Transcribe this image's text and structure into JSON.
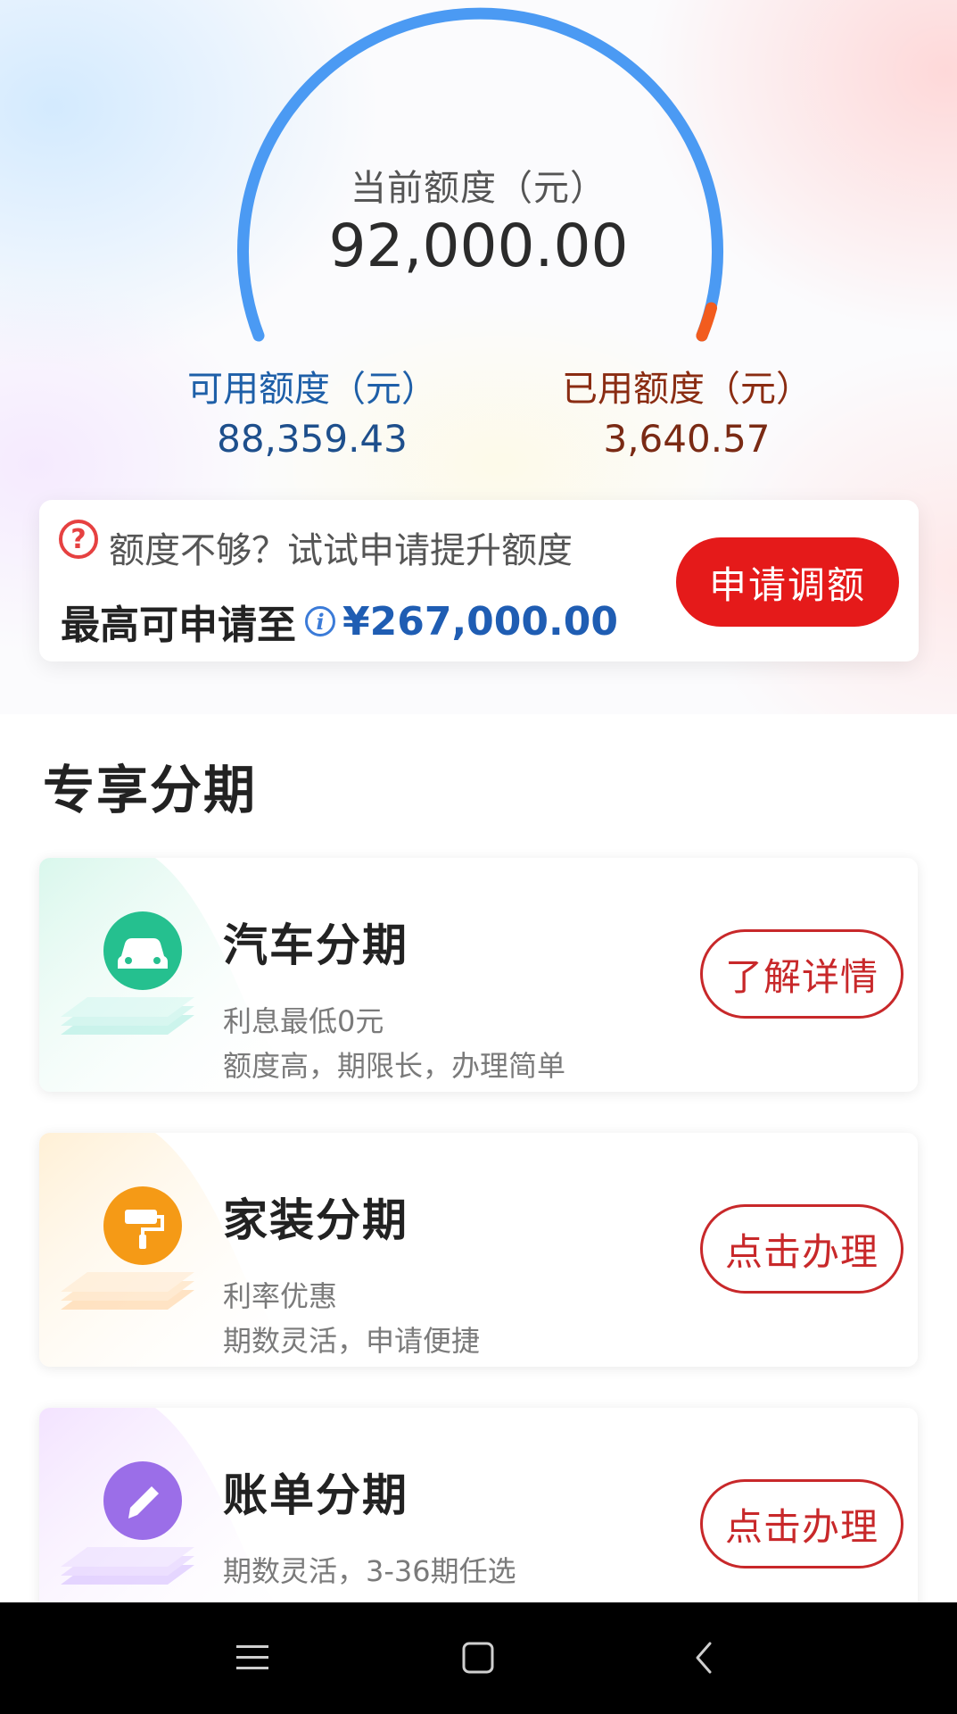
{
  "credit": {
    "current_label": "当前额度（元）",
    "current_value": "92,000.00",
    "available_label": "可用额度（元）",
    "available_value": "88,359.43",
    "used_label": "已用额度（元）",
    "used_value": "3,640.57",
    "used_fraction": 0.04
  },
  "upgrade": {
    "tip": "额度不够？试试申请提升额度",
    "max_label": "最高可申请至",
    "max_amount": "¥267,000.00",
    "button": "申请调额"
  },
  "section": {
    "title": "专享分期"
  },
  "cards": [
    {
      "title": "汽车分期",
      "desc1": "利息最低0元",
      "desc2": "额度高，期限长，办理简单",
      "button": "了解详情",
      "icon": "car-icon",
      "color": "#25c08f"
    },
    {
      "title": "家装分期",
      "desc1": "利率优惠",
      "desc2": "期数灵活，申请便捷",
      "button": "点击办理",
      "icon": "paint-roller-icon",
      "color": "#f59a16"
    },
    {
      "title": "账单分期",
      "desc1": "期数灵活，3-36期任选",
      "desc2": "",
      "button": "点击办理",
      "icon": "pencil-icon",
      "color": "#9b6ee8"
    }
  ],
  "colors": {
    "gauge_blue": "#4b9af3",
    "gauge_red": "#f25c1e",
    "primary_red": "#e51a1a",
    "link_blue": "#1f5db3"
  },
  "nav": {
    "icons": [
      "menu-icon",
      "home-icon",
      "back-icon"
    ]
  }
}
